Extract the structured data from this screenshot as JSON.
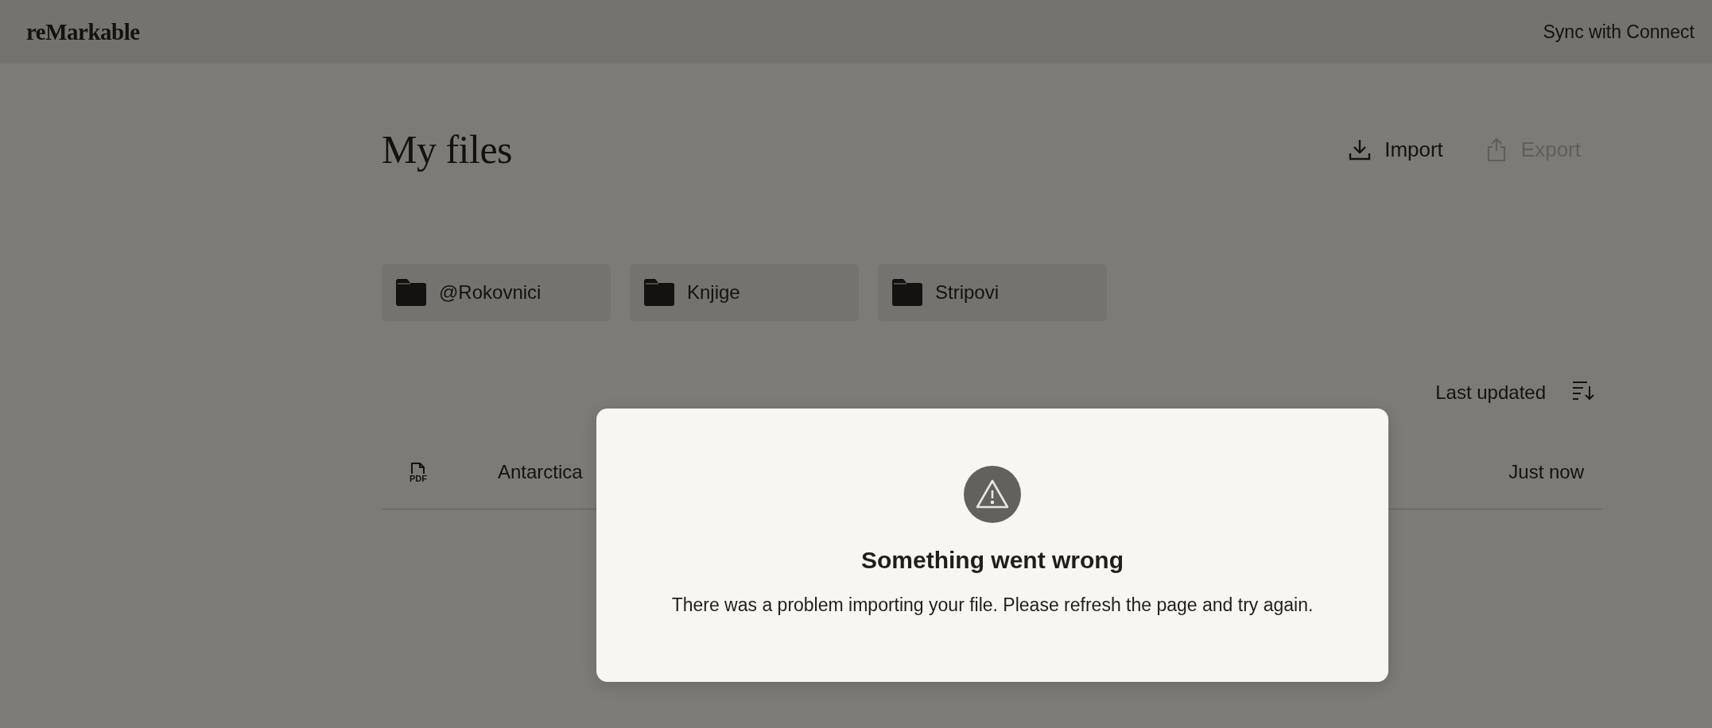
{
  "header": {
    "logo": "reMarkable",
    "sync_link": "Sync with Connect"
  },
  "page_title": "My files",
  "actions": [
    {
      "kind": "import",
      "label": "Import",
      "disabled": false
    },
    {
      "kind": "export",
      "label": "Export",
      "disabled": true
    }
  ],
  "folders": [
    {
      "name": "@Rokovnici"
    },
    {
      "name": "Knjige"
    },
    {
      "name": "Stripovi"
    }
  ],
  "sort": {
    "label": "Last updated"
  },
  "files": [
    {
      "kind": "pdf",
      "type_label": "PDF",
      "name": "Antarctica",
      "modified": "Just now"
    }
  ],
  "dialog": {
    "title": "Something went wrong",
    "message": "There was a problem importing your file. Please refresh the page and try again."
  }
}
